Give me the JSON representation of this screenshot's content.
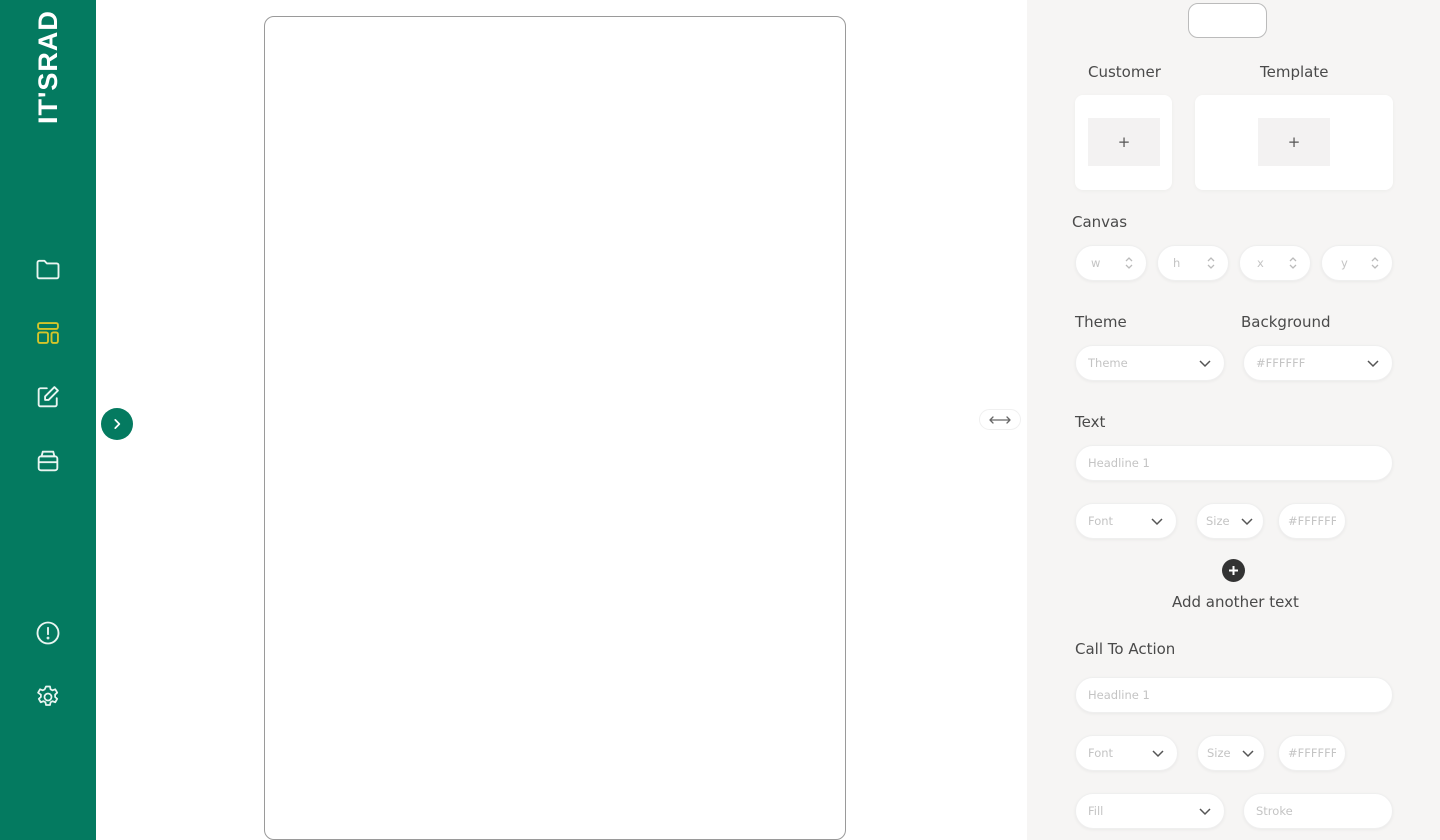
{
  "brand": {
    "name": "IT'SRAD"
  },
  "sidebar": {
    "items": [
      {
        "icon": "folder-icon",
        "active": false
      },
      {
        "icon": "layout-icon",
        "active": true
      },
      {
        "icon": "edit-icon",
        "active": false
      },
      {
        "icon": "archive-icon",
        "active": false
      }
    ],
    "bottom_items": [
      {
        "icon": "info-icon"
      },
      {
        "icon": "settings-icon"
      }
    ],
    "colors": {
      "background": "#047a60",
      "icon": "#ffffff",
      "active_icon": "#d4c52a"
    }
  },
  "panel": {
    "customer": {
      "label": "Customer",
      "add_label": "+"
    },
    "template": {
      "label": "Template",
      "add_label": "+"
    },
    "canvas": {
      "label": "Canvas",
      "fields": [
        {
          "placeholder": "w"
        },
        {
          "placeholder": "h"
        },
        {
          "placeholder": "x"
        },
        {
          "placeholder": "y"
        }
      ]
    },
    "theme": {
      "label": "Theme",
      "placeholder": "Theme"
    },
    "background": {
      "label": "Background",
      "value": "#FFFFFF"
    },
    "text": {
      "label": "Text",
      "headline_placeholder": "Headline 1",
      "font_placeholder": "Font",
      "size_placeholder": "Size",
      "color_value": "#FFFFFF",
      "add_label": "Add another text"
    },
    "cta": {
      "label": "Call To Action",
      "headline_placeholder": "Headline 1",
      "font_placeholder": "Font",
      "size_placeholder": "Size",
      "color_value": "#FFFFFF",
      "fill_placeholder": "Fill",
      "stroke_placeholder": "Stroke"
    }
  }
}
